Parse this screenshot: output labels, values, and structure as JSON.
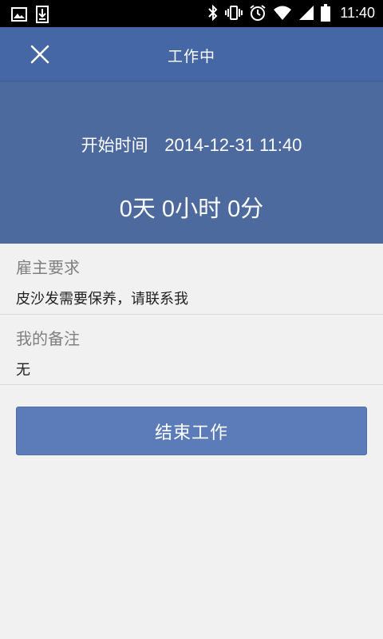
{
  "status_bar": {
    "time": "11:40",
    "left_icons": [
      "image-icon",
      "download-icon"
    ],
    "right_icons": [
      "bluetooth-icon",
      "vibrate-icon",
      "alarm-icon",
      "wifi-icon",
      "signal-icon",
      "battery-icon"
    ]
  },
  "header": {
    "title": "工作中",
    "close_icon": "close-icon"
  },
  "hero": {
    "start_label": "开始时间",
    "start_value": "2014-12-31 11:40",
    "duration": "0天 0小时 0分"
  },
  "employer_request": {
    "title": "雇主要求",
    "value": "皮沙发需要保养，请联系我"
  },
  "my_note": {
    "title": "我的备注",
    "value": "无"
  },
  "end_button_label": "结束工作",
  "colors": {
    "header": "#4567a5",
    "hero": "#4c6a9e",
    "button": "#5b7cb9",
    "background": "#f1f1f1"
  }
}
